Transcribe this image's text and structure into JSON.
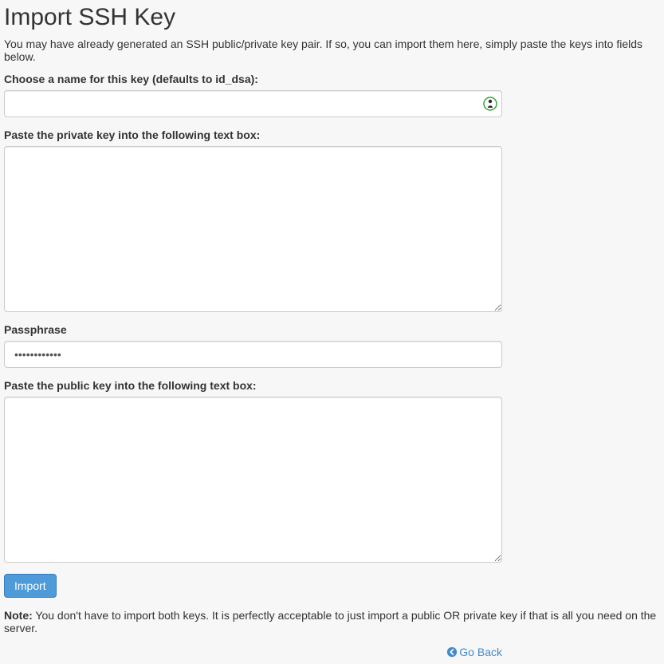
{
  "header": {
    "title": "Import SSH Key",
    "intro": "You may have already generated an SSH public/private key pair. If so, you can import them here, simply paste the keys into fields below."
  },
  "form": {
    "name": {
      "label": "Choose a name for this key (defaults to id_dsa):",
      "value": ""
    },
    "private_key": {
      "label": "Paste the private key into the following text box:",
      "value": ""
    },
    "passphrase": {
      "label": "Passphrase",
      "value": "••••••••••••"
    },
    "public_key": {
      "label": "Paste the public key into the following text box:",
      "value": ""
    },
    "submit_label": "Import"
  },
  "note": {
    "prefix": "Note:",
    "text": " You don't have to import both keys. It is perfectly acceptable to just import a public OR private key if that is all you need on the server."
  },
  "footer": {
    "go_back_label": "Go Back"
  },
  "icons": {
    "password_manager": "password-manager-icon",
    "arrow_left": "arrow-circle-left-icon"
  }
}
